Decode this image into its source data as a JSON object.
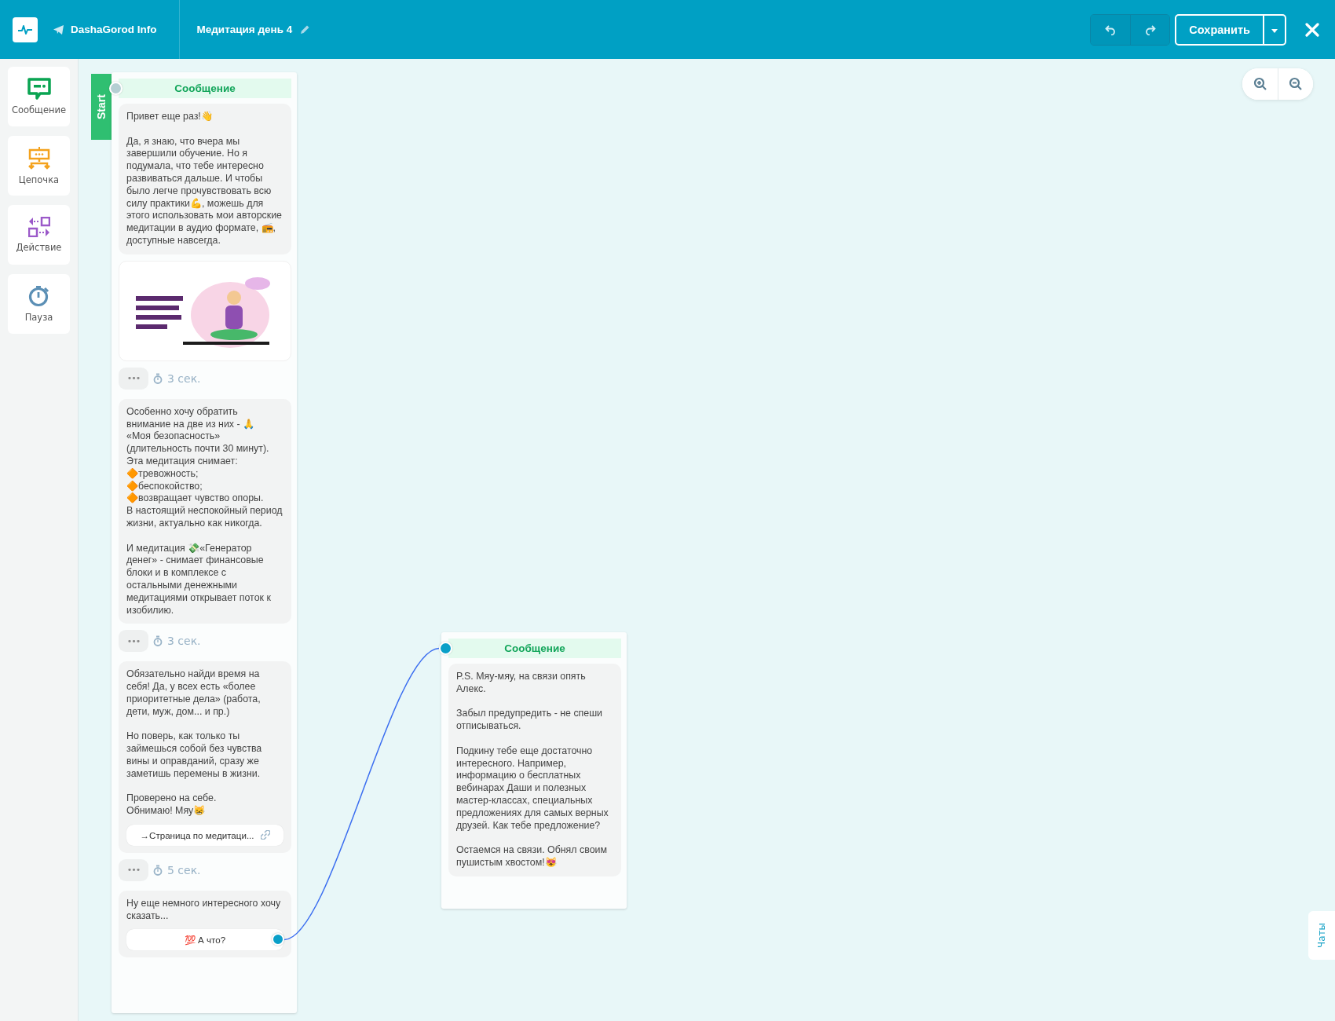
{
  "header": {
    "bot_name": "DashaGorod Info",
    "flow_title": "Медитация день 4",
    "save_button": "Сохранить"
  },
  "sidebar": {
    "items": [
      {
        "kind": "message",
        "label": "Сообщение"
      },
      {
        "kind": "chain",
        "label": "Цепочка"
      },
      {
        "kind": "action",
        "label": "Действие"
      },
      {
        "kind": "pause",
        "label": "Пауза"
      }
    ]
  },
  "canvas": {
    "nodes": [
      {
        "title": "Сообщение",
        "start_label": "Start",
        "input_connected": false,
        "items": [
          {
            "kind": "text",
            "text": "Привет еще раз!👋\n\nДа, я знаю, что вчера мы завершили обучение. Но я подумала, что тебе интересно развиваться дальше. И чтобы было легче прочувствовать всю силу практики💪, можешь для этого использовать мои авторские медитации в аудио формате, 📻, доступные навсегда."
          },
          {
            "kind": "image"
          },
          {
            "kind": "delay",
            "dots": "•••",
            "text": "3 сек."
          },
          {
            "kind": "text",
            "text": "Особенно хочу обратить внимание на две из них - 🙏\n«Моя безопасность» (длительность почти 30 минут).\nЭта медитация снимает:\n🔶тревожность;\n🔶беспокойство;\n🔶возвращает чувство опоры.\nВ настоящий неспокойный период жизни, актуально как никогда.\n\nИ медитация 💸«Генератор денег» - снимает финансовые блоки и в комплексе с остальными денежными медитациями открывает поток к изобилию."
          },
          {
            "kind": "delay",
            "dots": "•••",
            "text": "3 сек."
          },
          {
            "kind": "text",
            "text": "Обязательно найди время на себя! Да, у всех есть «более приоритетные дела» (работа, дети, муж, дом... и пр.)\n\nНо поверь, как только ты займешься собой без чувства вины и оправданий, сразу же заметишь перемены в жизни.\n\nПроверено на себе.\nОбнимаю! Мяу😸",
            "buttons": [
              {
                "kind": "link",
                "text": "→Страница по медитаци..."
              }
            ]
          },
          {
            "kind": "delay",
            "dots": "•••",
            "text": "5 сек."
          },
          {
            "kind": "text",
            "text": "Ну еще немного интересного хочу сказать...",
            "buttons": [
              {
                "kind": "reply",
                "text": "💯 А что?"
              }
            ]
          }
        ]
      },
      {
        "title": "Сообщение",
        "input_connected": true,
        "items": [
          {
            "kind": "text",
            "text": "P.S. Мяу-мяу, на связи опять Алекс.\n\nЗабыл предупредить - не спеши отписываться.\n\nПодкину тебе еще достаточно интересного. Например, информацию о бесплатных вебинарах Даши и полезных мастер-классах, специальных предложениях для самых верных друзей. Как тебе предложение?\n\nОстаемся на связи. Обнял своим пушистым хвостом!😻"
          }
        ]
      }
    ],
    "chats_tab": "Чаты"
  }
}
